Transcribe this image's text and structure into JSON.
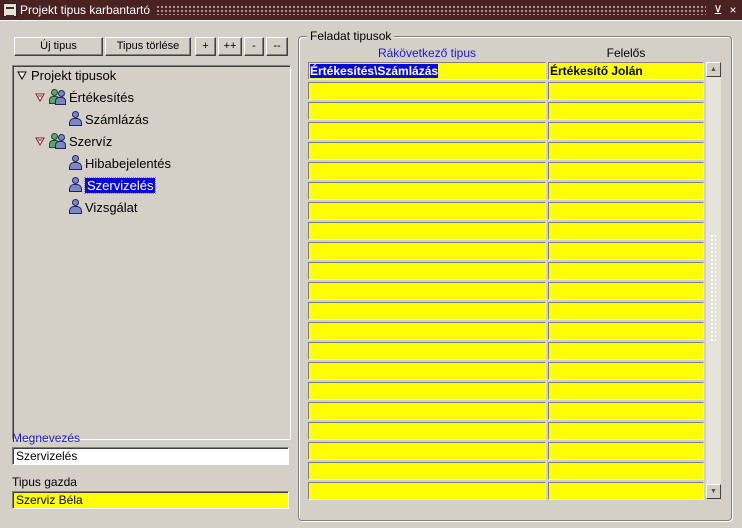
{
  "window": {
    "title": "Projekt tipus karbantartó",
    "controls": {
      "minimize": "⊻",
      "close": "×"
    }
  },
  "toolbar": {
    "new_type": "Új tipus",
    "delete_type": "Tipus törlése",
    "expand": "+",
    "expand_all": "++",
    "collapse": "-",
    "collapse_all": "--"
  },
  "tree": {
    "root": "Projekt tipusok",
    "groups": [
      {
        "label": "Értékesítés",
        "children": [
          "Számlázás"
        ]
      },
      {
        "label": "Szervíz",
        "children": [
          "Hibabejelentés",
          "Szervizelés",
          "Vizsgálat"
        ]
      }
    ],
    "selected": "Szervizelés"
  },
  "form": {
    "name_label": "Megnevezés",
    "name_value": "Szervizelés",
    "owner_label": "Tipus gazda",
    "owner_value": "Szerviz Béla"
  },
  "tasks": {
    "title": "Feladat tipusok",
    "columns": [
      "Rákövetkező tipus",
      "Felelős"
    ],
    "rows": [
      [
        "Értékesítés\\Számlázás",
        "Értékesítő Jolán"
      ]
    ],
    "visible_row_count": 22
  },
  "colors": {
    "titlebar": "#4a2222",
    "window_bg": "#d4d0c8",
    "record_yellow": "#ffff00",
    "selection_blue": "#0a0ad8",
    "prompt_blue": "#1a1ac8"
  }
}
